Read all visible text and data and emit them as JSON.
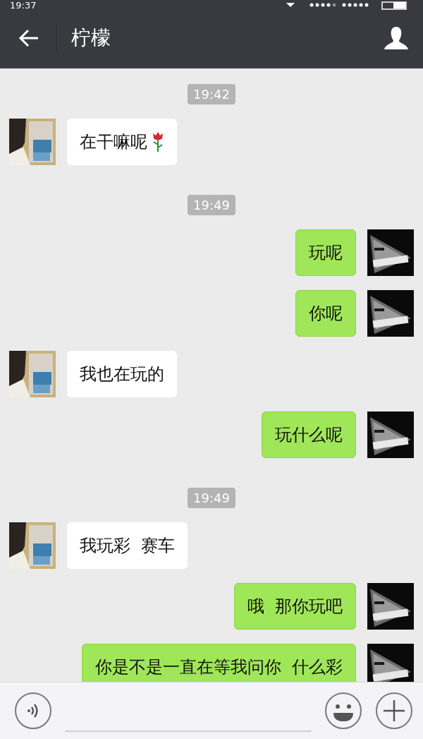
{
  "status_bar": {
    "time": "19:37"
  },
  "header": {
    "title": "柠檬"
  },
  "messages": [
    {
      "kind": "time",
      "text": "19:42"
    },
    {
      "kind": "received",
      "text": "在干嘛呢",
      "rose": true
    },
    {
      "kind": "time",
      "text": "19:49"
    },
    {
      "kind": "sent",
      "text": "玩呢"
    },
    {
      "kind": "sent",
      "text": "你呢"
    },
    {
      "kind": "received",
      "text": "我也在玩的"
    },
    {
      "kind": "sent",
      "text": "玩什么呢"
    },
    {
      "kind": "time",
      "text": "19:49"
    },
    {
      "kind": "received",
      "text": "我玩彩  赛车"
    },
    {
      "kind": "sent",
      "text": "哦  那你玩吧"
    },
    {
      "kind": "sent",
      "text": "你是不是一直在等我问你  什么彩"
    }
  ]
}
